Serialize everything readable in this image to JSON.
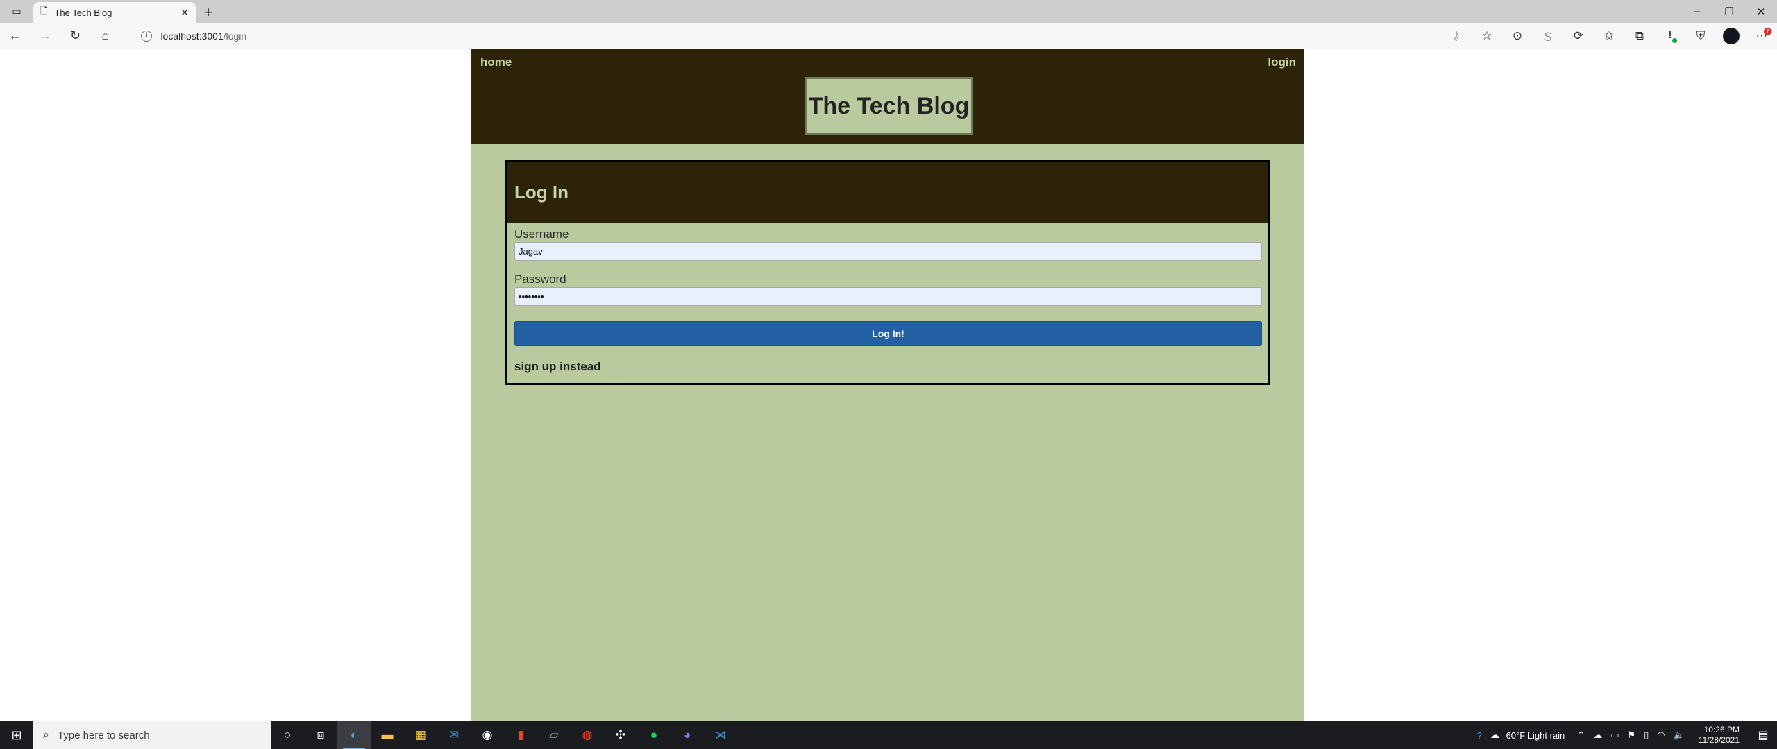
{
  "browser": {
    "tab_title": "The Tech Blog",
    "tab_close": "✕",
    "new_tab": "+",
    "url_host": "localhost:3001",
    "url_path": "/login",
    "window_controls": {
      "minimize": "–",
      "restore": "❐",
      "close": "✕"
    },
    "profile_badge": "1"
  },
  "site": {
    "nav_home": "home",
    "nav_login": "login",
    "brand": "The Tech Blog"
  },
  "login_form": {
    "title": "Log In",
    "username_label": "Username",
    "username_value": "Jagav",
    "password_label": "Password",
    "password_value": "••••••••",
    "submit_label": "Log In!",
    "signup_link": "sign up instead"
  },
  "taskbar": {
    "search_placeholder": "Type here to search",
    "weather": "60°F  Light rain",
    "time": "10:26 PM",
    "date": "11/28/2021"
  },
  "colors": {
    "header_bg": "#2d2308",
    "page_bg": "#b9ca9f",
    "accent_text": "#c5d6a8",
    "button_blue": "#2361a4"
  }
}
